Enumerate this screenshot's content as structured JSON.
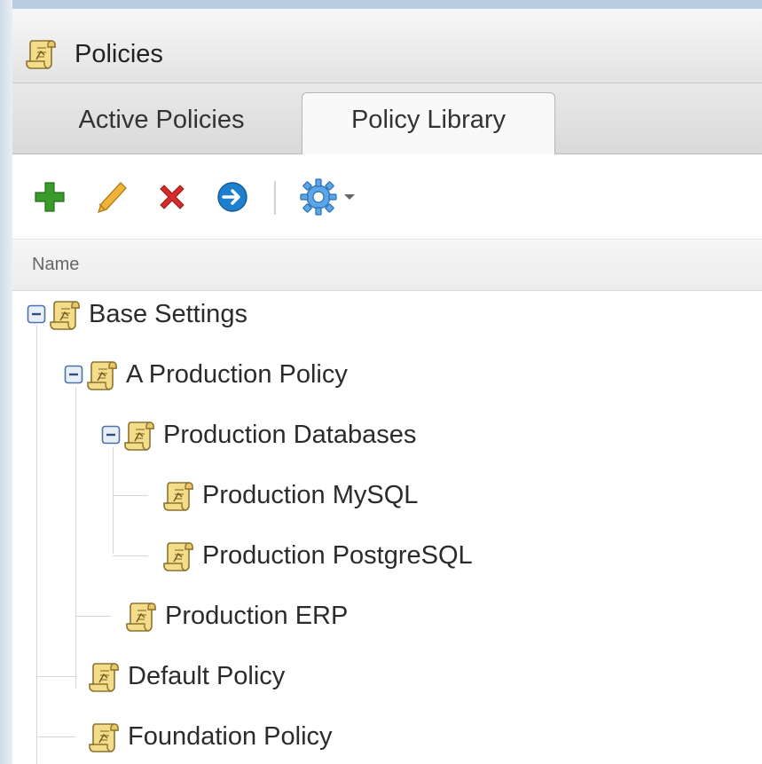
{
  "window": {
    "title": "Policies",
    "icon": "policy-scroll-icon"
  },
  "tabs": [
    {
      "label": "Active Policies",
      "active": false
    },
    {
      "label": "Policy Library",
      "active": true
    }
  ],
  "toolbar": {
    "buttons": [
      {
        "name": "add-button",
        "icon": "plus-icon",
        "color": "#3a9a2c"
      },
      {
        "name": "edit-button",
        "icon": "pencil-icon",
        "color": "#e0a126"
      },
      {
        "name": "delete-button",
        "icon": "x-icon",
        "color": "#d42b2b"
      },
      {
        "name": "apply-button",
        "icon": "arrow-right-circle-icon",
        "color": "#1f7fcf"
      },
      {
        "name": "settings-menu-button",
        "icon": "gear-icon",
        "color": "#3b8fd8"
      }
    ]
  },
  "columns": {
    "name": "Name"
  },
  "tree": [
    {
      "label": "Base Settings",
      "level": 0,
      "expanded": true
    },
    {
      "label": "A Production Policy",
      "level": 1,
      "expanded": true
    },
    {
      "label": "Production Databases",
      "level": 2,
      "expanded": true
    },
    {
      "label": "Production MySQL",
      "level": 3
    },
    {
      "label": "Production PostgreSQL",
      "level": 3
    },
    {
      "label": "Production ERP",
      "level": 2
    },
    {
      "label": "Default Policy",
      "level": 1
    },
    {
      "label": "Foundation Policy",
      "level": 1
    }
  ],
  "colors": {
    "icon_fill": "#f3dd8a",
    "icon_stroke": "#8c7431",
    "expander": "#4b73a6"
  }
}
